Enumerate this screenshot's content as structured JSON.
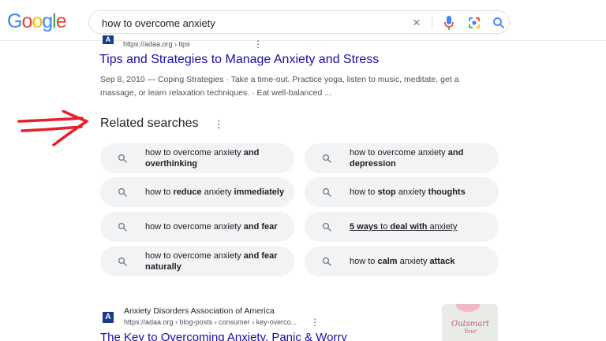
{
  "header": {
    "logo_letters": [
      "G",
      "o",
      "o",
      "g",
      "l",
      "e"
    ],
    "search_query": "how to overcome anxiety",
    "clear_symbol": "×"
  },
  "result1": {
    "favicon_letter": "A",
    "url": "https://adaa.org › tips",
    "title": "Tips and Strategies to Manage Anxiety and Stress",
    "snippet": "Sep 8, 2010 — Coping Strategies · Take a time-out. Practice yoga, listen to music, meditate, get a massage, or learn relaxation techniques. · Eat well-balanced ..."
  },
  "related": {
    "heading": "Related searches",
    "chips": [
      {
        "parts": [
          {
            "t": "how to overcome anxiety "
          },
          {
            "t": "and overthinking",
            "b": true
          }
        ]
      },
      {
        "parts": [
          {
            "t": "how to overcome anxiety "
          },
          {
            "t": "and depression",
            "b": true
          }
        ]
      },
      {
        "parts": [
          {
            "t": "how to "
          },
          {
            "t": "reduce",
            "b": true
          },
          {
            "t": " anxiety "
          },
          {
            "t": "immediately",
            "b": true
          }
        ]
      },
      {
        "parts": [
          {
            "t": "how to "
          },
          {
            "t": "stop",
            "b": true
          },
          {
            "t": " anxiety "
          },
          {
            "t": "thoughts",
            "b": true
          }
        ]
      },
      {
        "parts": [
          {
            "t": "how to overcome anxiety "
          },
          {
            "t": "and fear",
            "b": true
          }
        ]
      },
      {
        "parts": [
          {
            "t": "5 ways",
            "b": true,
            "u": true
          },
          {
            "t": " to ",
            "u": true
          },
          {
            "t": "deal with",
            "b": true,
            "u": true
          },
          {
            "t": " anxiety",
            "u": true
          }
        ]
      },
      {
        "parts": [
          {
            "t": "how to overcome anxiety "
          },
          {
            "t": "and fear naturally",
            "b": true
          }
        ]
      },
      {
        "parts": [
          {
            "t": "how to "
          },
          {
            "t": "calm",
            "b": true
          },
          {
            "t": " anxiety "
          },
          {
            "t": "attack",
            "b": true
          }
        ]
      }
    ]
  },
  "result2": {
    "favicon_letter": "A",
    "site_name": "Anxiety Disorders Association of America",
    "url": "https://adaa.org › blog-posts › consumer › key-overco...",
    "title": "The Key to Overcoming Anxiety, Panic & Worry",
    "thumb_text_1": "Outsmart",
    "thumb_text_2": "Your"
  },
  "colors": {
    "link": "#1a0dab",
    "annotation_arrow": "#e8202a",
    "chip_bg": "#f1f3f4"
  }
}
